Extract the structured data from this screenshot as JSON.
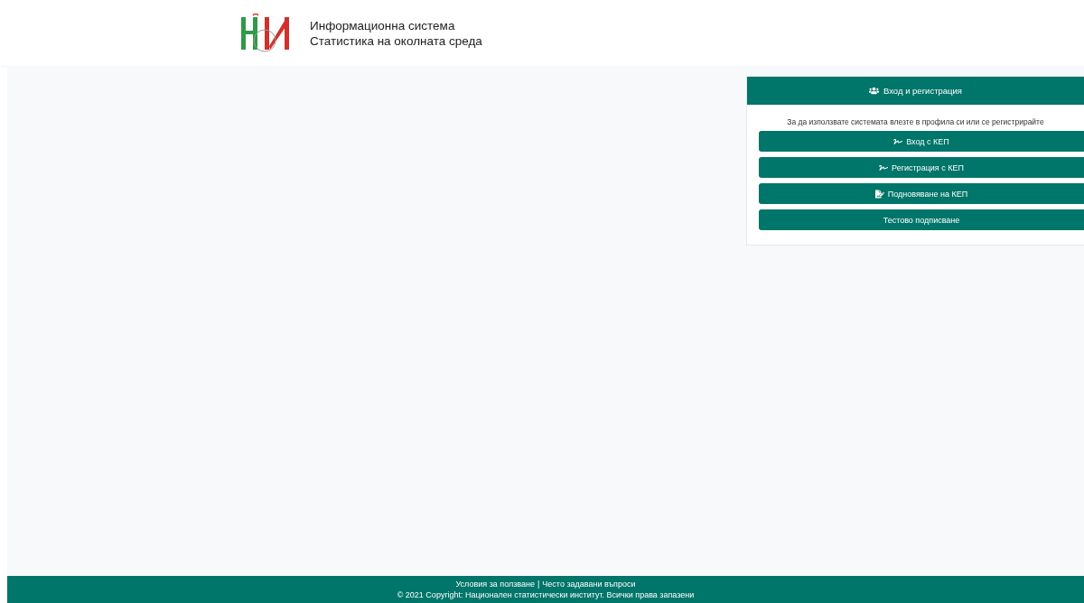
{
  "header": {
    "title_line_1": "Информационна система",
    "title_line_2": "Статистика на околната среда"
  },
  "login_card": {
    "title": "Вход и регистрация",
    "intro": "За да използвате системата влезте в профила си или се регистрирайте",
    "buttons": [
      {
        "label": "Вход с КЕП",
        "kind": "signature"
      },
      {
        "label": "Регистрация с КЕП",
        "kind": "signature"
      },
      {
        "label": "Подновяване на КЕП",
        "kind": "renew"
      },
      {
        "label": "Тестово подписване",
        "kind": "plain"
      }
    ]
  },
  "footer": {
    "links": [
      "Условия за ползване",
      "Често задавани въпроси"
    ],
    "separator": "|",
    "copyright": "© 2021 Copyright: Национален статистически институт. Всички права запазени"
  }
}
